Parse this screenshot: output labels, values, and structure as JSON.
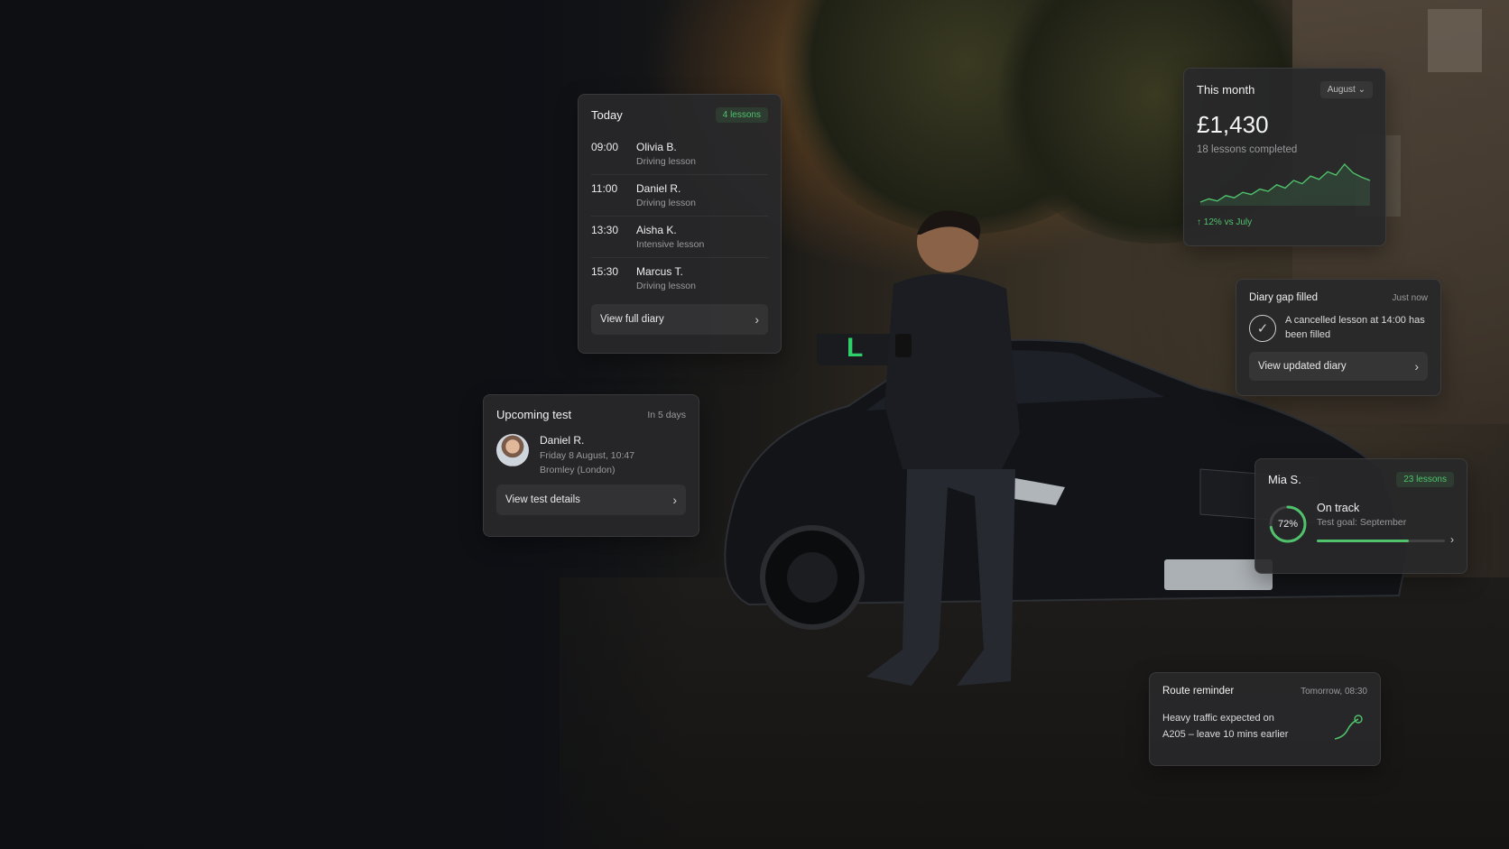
{
  "today": {
    "title": "Today",
    "badge": "4 lessons",
    "lessons": [
      {
        "time": "09:00",
        "name": "Olivia B.",
        "type": "Driving lesson"
      },
      {
        "time": "11:00",
        "name": "Daniel R.",
        "type": "Driving lesson"
      },
      {
        "time": "13:30",
        "name": "Aisha K.",
        "type": "Intensive lesson"
      },
      {
        "time": "15:30",
        "name": "Marcus T.",
        "type": "Driving lesson"
      }
    ],
    "button": "View full diary"
  },
  "test": {
    "title": "Upcoming test",
    "when": "In 5 days",
    "name": "Daniel R.",
    "date": "Friday 8 August, 10:47",
    "place": "Bromley (London)",
    "button": "View test details"
  },
  "month": {
    "title": "This month",
    "dropdown": "August",
    "amount": "£1,430",
    "subtitle": "18 lessons completed",
    "trend": "12% vs July",
    "chart_values": [
      20,
      23,
      21,
      26,
      24,
      29,
      27,
      32,
      30,
      36,
      33,
      40,
      37,
      44,
      41,
      48,
      45,
      55,
      47,
      43,
      40
    ],
    "accent": "#4fc26b"
  },
  "gap": {
    "title": "Diary gap filled",
    "time": "Just now",
    "message": "A cancelled lesson at 14:00 has been filled",
    "button": "View updated diary"
  },
  "mia": {
    "name": "Mia S.",
    "badge": "23 lessons",
    "percent_label": "72%",
    "progress": 0.72,
    "status": "On track",
    "goal": "Test goal: September"
  },
  "route": {
    "title": "Route reminder",
    "time": "Tomorrow, 08:30",
    "line1": "Heavy traffic expected on",
    "line2": "A205 – leave 10 mins earlier"
  }
}
